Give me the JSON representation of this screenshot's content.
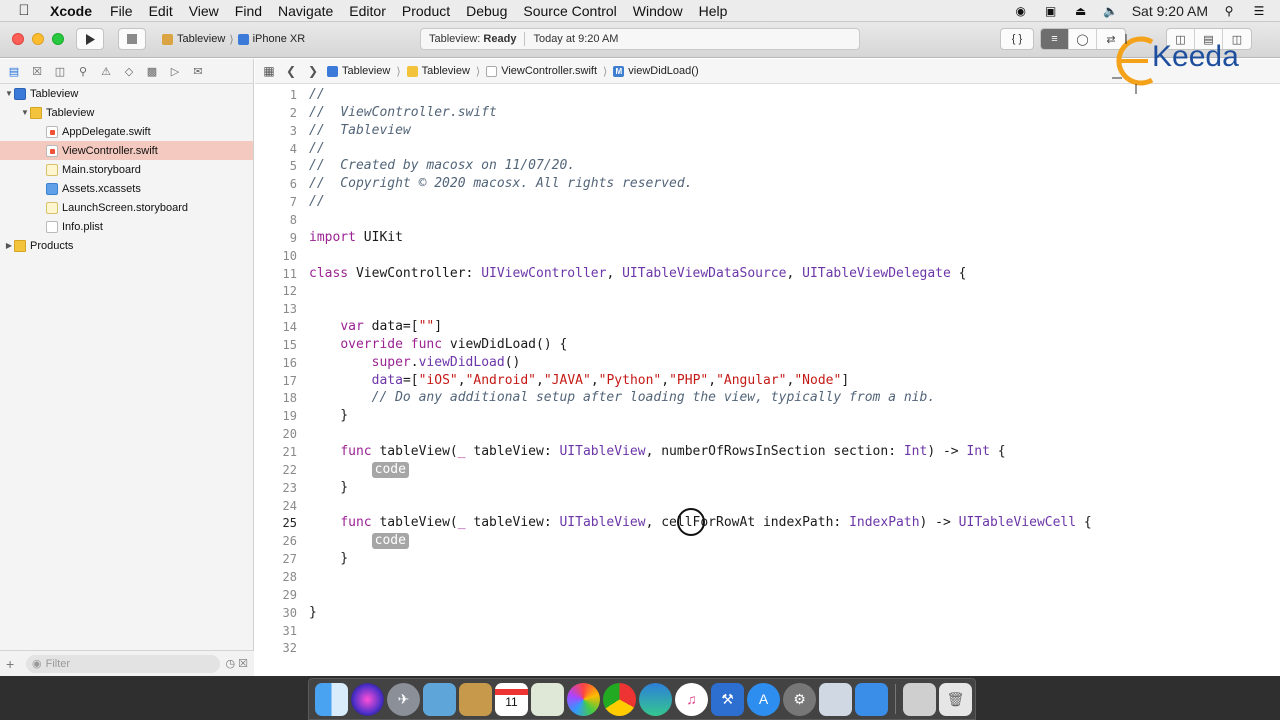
{
  "menubar": {
    "app_name": "Xcode",
    "items": [
      "File",
      "Edit",
      "View",
      "Find",
      "Navigate",
      "Editor",
      "Product",
      "Debug",
      "Source Control",
      "Window",
      "Help"
    ],
    "clock": "Sat 9:20 AM"
  },
  "toolbar": {
    "scheme_project": "Tableview",
    "scheme_device": "iPhone XR",
    "activity_project": "Tableview:",
    "activity_status": "Ready",
    "activity_time": "Today at 9:20 AM",
    "library_label": "{ }"
  },
  "navigator": {
    "items": [
      {
        "label": "Tableview",
        "kind": "project",
        "level": 0,
        "disclosure": "▼"
      },
      {
        "label": "Tableview",
        "kind": "folder",
        "level": 1,
        "disclosure": "▼"
      },
      {
        "label": "AppDelegate.swift",
        "kind": "swift",
        "level": 2,
        "disclosure": ""
      },
      {
        "label": "ViewController.swift",
        "kind": "swift",
        "level": 2,
        "disclosure": "",
        "selected": true
      },
      {
        "label": "Main.storyboard",
        "kind": "storyboard",
        "level": 2,
        "disclosure": ""
      },
      {
        "label": "Assets.xcassets",
        "kind": "assets",
        "level": 2,
        "disclosure": ""
      },
      {
        "label": "LaunchScreen.storyboard",
        "kind": "storyboard",
        "level": 2,
        "disclosure": ""
      },
      {
        "label": "Info.plist",
        "kind": "plist",
        "level": 2,
        "disclosure": ""
      },
      {
        "label": "Products",
        "kind": "folder",
        "level": 0,
        "disclosure": "▶"
      }
    ],
    "filter_placeholder": "Filter"
  },
  "jumpbar": {
    "crumbs": [
      "Tableview",
      "Tableview",
      "ViewController.swift",
      "viewDidLoad()"
    ]
  },
  "editor": {
    "current_line": 25,
    "lines": [
      [
        {
          "t": "//",
          "c": "comment"
        }
      ],
      [
        {
          "t": "//  ViewController.swift",
          "c": "comment"
        }
      ],
      [
        {
          "t": "//  Tableview",
          "c": "comment"
        }
      ],
      [
        {
          "t": "//",
          "c": "comment"
        }
      ],
      [
        {
          "t": "//  Created by macosx on 11/07/20.",
          "c": "comment"
        }
      ],
      [
        {
          "t": "//  Copyright © 2020 macosx. All rights reserved.",
          "c": "comment"
        }
      ],
      [
        {
          "t": "//",
          "c": "comment"
        }
      ],
      [],
      [
        {
          "t": "import",
          "c": "kw"
        },
        {
          "t": " UIKit",
          "c": "plain"
        }
      ],
      [],
      [
        {
          "t": "class",
          "c": "kw"
        },
        {
          "t": " ViewController: ",
          "c": "plain"
        },
        {
          "t": "UIViewController",
          "c": "type"
        },
        {
          "t": ", ",
          "c": "plain"
        },
        {
          "t": "UITableViewDataSource",
          "c": "type"
        },
        {
          "t": ", ",
          "c": "plain"
        },
        {
          "t": "UITableViewDelegate",
          "c": "type"
        },
        {
          "t": " {",
          "c": "plain"
        }
      ],
      [],
      [],
      [
        {
          "t": "    ",
          "c": "plain"
        },
        {
          "t": "var",
          "c": "kw"
        },
        {
          "t": " data=[",
          "c": "plain"
        },
        {
          "t": "\"\"",
          "c": "str"
        },
        {
          "t": "]",
          "c": "plain"
        }
      ],
      [
        {
          "t": "    ",
          "c": "plain"
        },
        {
          "t": "override",
          "c": "kw"
        },
        {
          "t": " ",
          "c": "plain"
        },
        {
          "t": "func",
          "c": "kw"
        },
        {
          "t": " viewDidLoad() {",
          "c": "plain"
        }
      ],
      [
        {
          "t": "        ",
          "c": "plain"
        },
        {
          "t": "super",
          "c": "kw"
        },
        {
          "t": ".",
          "c": "plain"
        },
        {
          "t": "viewDidLoad",
          "c": "type"
        },
        {
          "t": "()",
          "c": "plain"
        }
      ],
      [
        {
          "t": "        ",
          "c": "plain"
        },
        {
          "t": "data",
          "c": "type"
        },
        {
          "t": "=[",
          "c": "plain"
        },
        {
          "t": "\"iOS\"",
          "c": "str"
        },
        {
          "t": ",",
          "c": "plain"
        },
        {
          "t": "\"Android\"",
          "c": "str"
        },
        {
          "t": ",",
          "c": "plain"
        },
        {
          "t": "\"JAVA\"",
          "c": "str"
        },
        {
          "t": ",",
          "c": "plain"
        },
        {
          "t": "\"Python\"",
          "c": "str"
        },
        {
          "t": ",",
          "c": "plain"
        },
        {
          "t": "\"PHP\"",
          "c": "str"
        },
        {
          "t": ",",
          "c": "plain"
        },
        {
          "t": "\"Angular\"",
          "c": "str"
        },
        {
          "t": ",",
          "c": "plain"
        },
        {
          "t": "\"Node\"",
          "c": "str"
        },
        {
          "t": "]",
          "c": "plain"
        }
      ],
      [
        {
          "t": "        ",
          "c": "plain"
        },
        {
          "t": "// Do any additional setup after loading the view, typically from a nib.",
          "c": "comment"
        }
      ],
      [
        {
          "t": "    }",
          "c": "plain"
        }
      ],
      [],
      [
        {
          "t": "    ",
          "c": "plain"
        },
        {
          "t": "func",
          "c": "kw"
        },
        {
          "t": " tableView(",
          "c": "plain"
        },
        {
          "t": "_",
          "c": "kw"
        },
        {
          "t": " tableView: ",
          "c": "plain"
        },
        {
          "t": "UITableView",
          "c": "type"
        },
        {
          "t": ", numberOfRowsInSection section: ",
          "c": "plain"
        },
        {
          "t": "Int",
          "c": "type"
        },
        {
          "t": ") -> ",
          "c": "plain"
        },
        {
          "t": "Int",
          "c": "type"
        },
        {
          "t": " {",
          "c": "plain"
        }
      ],
      [
        {
          "t": "        ",
          "c": "plain"
        },
        {
          "t": "code",
          "c": "placeholder"
        }
      ],
      [
        {
          "t": "    }",
          "c": "plain"
        }
      ],
      [],
      [
        {
          "t": "    ",
          "c": "plain"
        },
        {
          "t": "func",
          "c": "kw"
        },
        {
          "t": " tableView(",
          "c": "plain"
        },
        {
          "t": "_",
          "c": "kw"
        },
        {
          "t": " tableView: ",
          "c": "plain"
        },
        {
          "t": "UITableView",
          "c": "type"
        },
        {
          "t": ", cell",
          "c": "plain"
        },
        {
          "t": "ForRowAt indexPath: ",
          "c": "plain"
        },
        {
          "t": "IndexPath",
          "c": "type"
        },
        {
          "t": ") -> ",
          "c": "plain"
        },
        {
          "t": "UITableViewCell",
          "c": "type"
        },
        {
          "t": " {",
          "c": "plain"
        }
      ],
      [
        {
          "t": "        ",
          "c": "plain"
        },
        {
          "t": "code",
          "c": "placeholder"
        }
      ],
      [
        {
          "t": "    }",
          "c": "plain"
        }
      ],
      [],
      [],
      [
        {
          "t": "}",
          "c": "plain"
        }
      ],
      [],
      []
    ]
  },
  "watermark": {
    "text": "Keeda",
    "accent_color": "#f5a21b",
    "text_color": "#1d4f9e"
  },
  "dock": {
    "icons": [
      "finder-icon",
      "siri-icon",
      "launchpad-icon",
      "preview-icon",
      "notes-icon",
      "calendar-icon",
      "maps-icon",
      "photos-icon",
      "chrome-icon",
      "edge-icon",
      "music-icon",
      "xcode-icon",
      "app-store-icon",
      "system-preferences-icon",
      "ibooks-icon",
      "simulator-icon",
      "storage-icon",
      "trash-icon"
    ],
    "calendar_day": "11"
  },
  "colors": {
    "keyword": "#9b2393",
    "type": "#6c36a9",
    "string": "#c41a16",
    "comment": "#536579",
    "selection": "#f4c9bf"
  }
}
